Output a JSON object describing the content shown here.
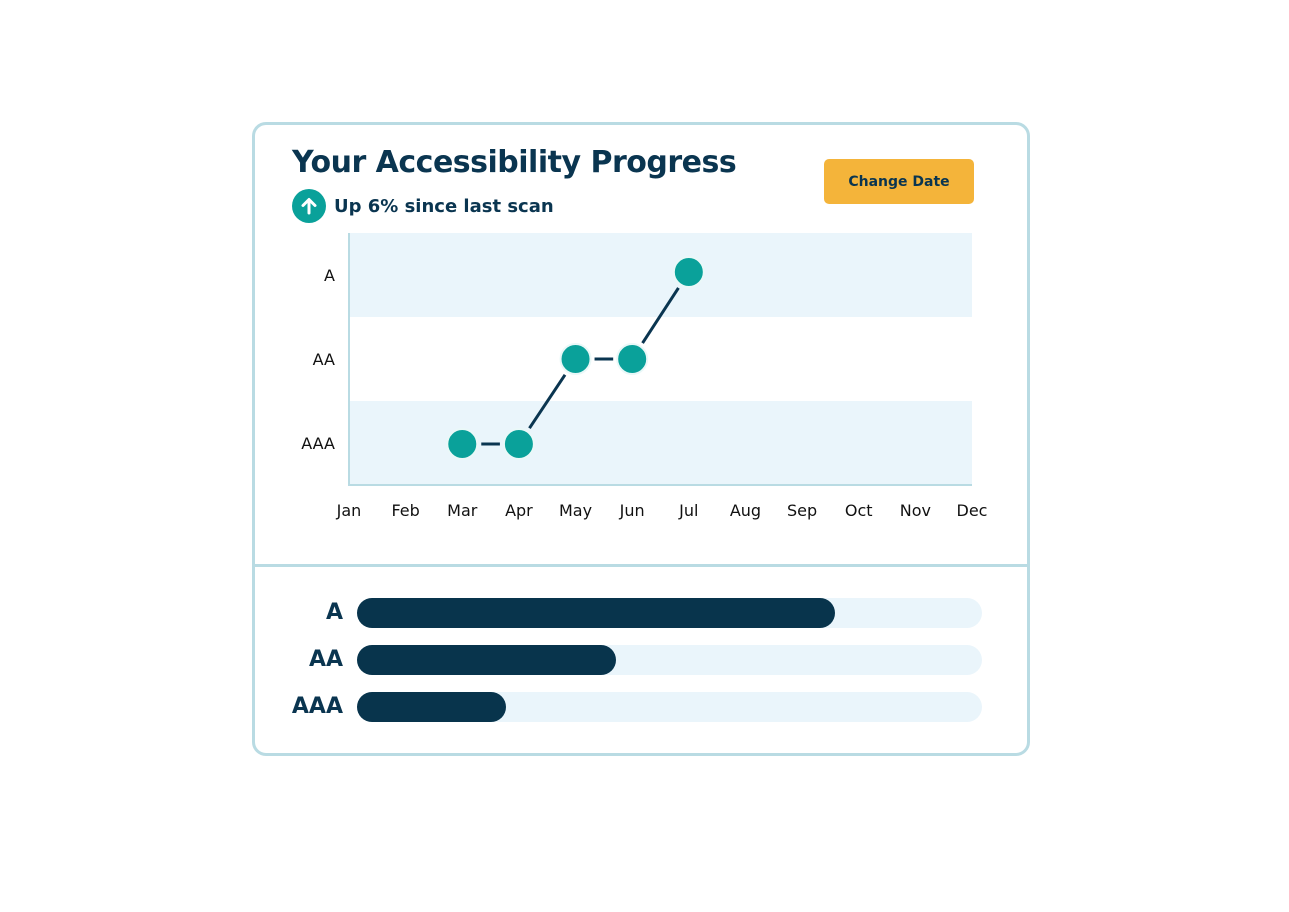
{
  "header": {
    "title": "Your Accessibility Progress",
    "trend_icon": "arrow-up-circle-icon",
    "trend_text": "Up 6% since last scan",
    "change_date_label": "Change Date"
  },
  "colors": {
    "primary_text": "#0a3550",
    "accent_teal": "#0aa19a",
    "button_yellow": "#f4b43a",
    "band_light": "#eaf5fb",
    "border": "#b9dbe3",
    "bar_fill": "#08344c"
  },
  "chart_data": {
    "type": "line",
    "title": "",
    "xlabel": "",
    "ylabel": "",
    "x": [
      "Jan",
      "Feb",
      "Mar",
      "Apr",
      "May",
      "Jun",
      "Jul",
      "Aug",
      "Sep",
      "Oct",
      "Nov",
      "Dec"
    ],
    "y_categories": [
      "AAA",
      "AA",
      "A"
    ],
    "points": [
      {
        "x": "Mar",
        "y": "AAA"
      },
      {
        "x": "Apr",
        "y": "AAA"
      },
      {
        "x": "May",
        "y": "AA"
      },
      {
        "x": "Jun",
        "y": "AA"
      },
      {
        "x": "Jul",
        "y": "A"
      }
    ],
    "grid": false,
    "bands": "alternating"
  },
  "levels": [
    {
      "label": "A",
      "progress": 0.765
    },
    {
      "label": "AA",
      "progress": 0.414
    },
    {
      "label": "AAA",
      "progress": 0.238
    }
  ]
}
